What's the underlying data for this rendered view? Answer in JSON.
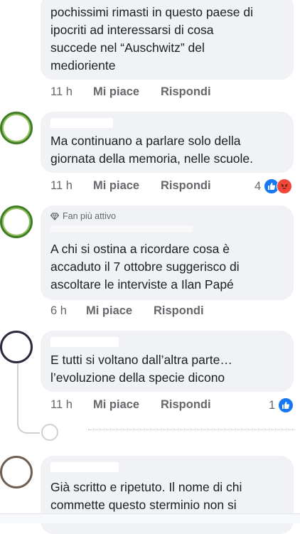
{
  "comments": [
    {
      "text_lines": [
        "pochissimi rimasti in questo paese di",
        "ipocriti ad interessarsi di cosa",
        "succede nel “Auschwitz” del",
        "medioriente"
      ],
      "time": "11 h",
      "like_label": "Mi piace",
      "reply_label": "Rispondi"
    },
    {
      "text_lines": [
        "Ma continuano a parlare solo della",
        "giornata della memoria, nelle scuole."
      ],
      "time": "11 h",
      "like_label": "Mi piace",
      "reply_label": "Rispondi",
      "reaction_count": "4",
      "reactions": [
        "like-icon",
        "angry-icon"
      ]
    },
    {
      "badge": "Fan più attivo",
      "text_lines": [
        "A chi si ostina a ricordare cosa è",
        "accaduto il 7 ottobre suggerisco di",
        "ascoltare le interviste a Ilan Papé"
      ],
      "time": "6 h",
      "like_label": "Mi piace",
      "reply_label": "Rispondi"
    },
    {
      "text_lines": [
        "E tutti si voltano dall’altra parte…",
        "l’evoluzione della specie dicono"
      ],
      "time": "11 h",
      "like_label": "Mi piace",
      "reply_label": "Rispondi",
      "reaction_count": "1",
      "reactions": [
        "like-icon"
      ]
    },
    {
      "text_lines": [
        "Già scritto e ripetuto. Il nome di chi",
        "commette questo sterminio non si"
      ]
    }
  ],
  "colors": {
    "bubble": "#f0f2f5",
    "action_text": "#65676b",
    "like_blue": "#1877f2",
    "angry_red": "#f0473a"
  }
}
